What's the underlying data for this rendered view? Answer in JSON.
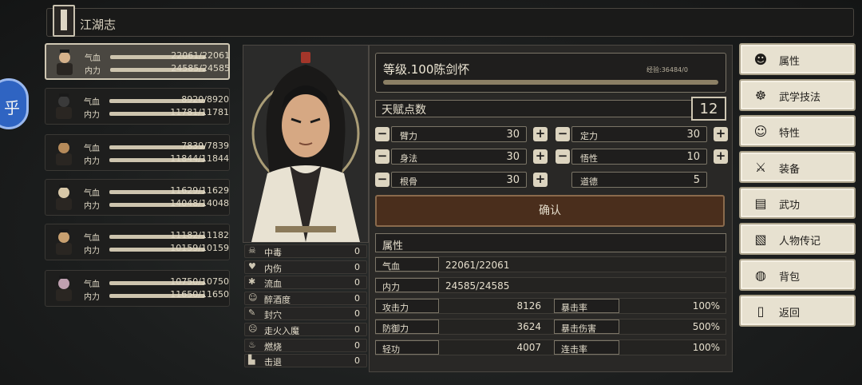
{
  "header": {
    "title": "江湖志"
  },
  "side_badge": {
    "label": "乎"
  },
  "team": [
    {
      "hp_label": "气血",
      "mp_label": "内力",
      "hp": "22061/22061",
      "mp": "24585/24585",
      "selected": true
    },
    {
      "hp_label": "气血",
      "mp_label": "内力",
      "hp": "8920/8920",
      "mp": "11781/11781",
      "selected": false
    },
    {
      "hp_label": "气血",
      "mp_label": "内力",
      "hp": "7839/7839",
      "mp": "11844/11844",
      "selected": false
    },
    {
      "hp_label": "气血",
      "mp_label": "内力",
      "hp": "11629/11629",
      "mp": "14048/14048",
      "selected": false
    },
    {
      "hp_label": "气血",
      "mp_label": "内力",
      "hp": "11182/11182",
      "mp": "10159/10159",
      "selected": false
    },
    {
      "hp_label": "气血",
      "mp_label": "内力",
      "hp": "10750/10750",
      "mp": "11650/11650",
      "selected": false
    }
  ],
  "character": {
    "name": "等级.100陈剑怀",
    "exp": "经验:36484/0",
    "talent_label": "天赋点数",
    "talent_points": "12"
  },
  "attributes": [
    {
      "label": "臂力",
      "value": "30"
    },
    {
      "label": "定力",
      "value": "30"
    },
    {
      "label": "身法",
      "value": "30"
    },
    {
      "label": "悟性",
      "value": "10"
    },
    {
      "label": "根骨",
      "value": "30"
    },
    {
      "label": "道德",
      "value": "5"
    }
  ],
  "confirm_label": "确认",
  "props": {
    "header": "属性",
    "hp_label": "气血",
    "hp": "22061/22061",
    "mp_label": "内力",
    "mp": "24585/24585",
    "rows": [
      {
        "l1": "攻击力",
        "v1": "8126",
        "l2": "暴击率",
        "v2": "100%"
      },
      {
        "l1": "防御力",
        "v1": "3624",
        "l2": "暴击伤害",
        "v2": "500%"
      },
      {
        "l1": "轻功",
        "v1": "4007",
        "l2": "连击率",
        "v2": "100%"
      }
    ]
  },
  "status": [
    {
      "icon": "skull-icon",
      "label": "中毒",
      "value": "0"
    },
    {
      "icon": "broken-heart-icon",
      "label": "内伤",
      "value": "0"
    },
    {
      "icon": "blood-drop-icon",
      "label": "流血",
      "value": "0"
    },
    {
      "icon": "drunk-face-icon",
      "label": "醉酒度",
      "value": "0"
    },
    {
      "icon": "acupoint-icon",
      "label": "封穴",
      "value": "0"
    },
    {
      "icon": "demon-icon",
      "label": "走火入魔",
      "value": "0"
    },
    {
      "icon": "fire-icon",
      "label": "燃烧",
      "value": "0"
    },
    {
      "icon": "knockback-icon",
      "label": "击退",
      "value": "0"
    }
  ],
  "menu": [
    {
      "label": "属性",
      "icon": "character-icon"
    },
    {
      "label": "武学技法",
      "icon": "martial-skill-icon"
    },
    {
      "label": "特性",
      "icon": "trait-icon"
    },
    {
      "label": "装备",
      "icon": "sword-icon"
    },
    {
      "label": "武功",
      "icon": "scroll-book-icon"
    },
    {
      "label": "人物传记",
      "icon": "biography-icon"
    },
    {
      "label": "背包",
      "icon": "bag-icon"
    },
    {
      "label": "返回",
      "icon": "door-icon"
    }
  ]
}
